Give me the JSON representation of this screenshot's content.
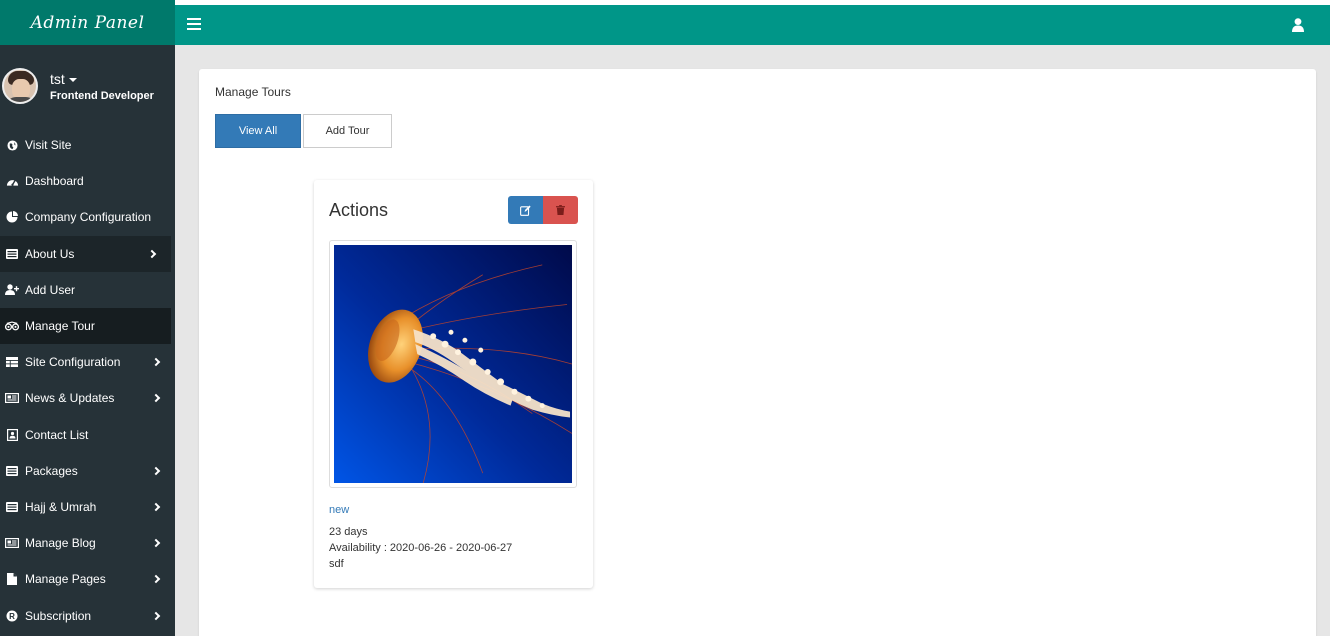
{
  "brand": "Admin Panel",
  "profile": {
    "name": "tst",
    "role": "Frontend Developer"
  },
  "menu": [
    {
      "label": "Visit Site",
      "icon": "globe-icon",
      "has_sub": false
    },
    {
      "label": "Dashboard",
      "icon": "tachometer-icon",
      "has_sub": false
    },
    {
      "label": "Company Configuration",
      "icon": "pie-chart-icon",
      "has_sub": false
    },
    {
      "label": "About Us",
      "icon": "list-icon",
      "has_sub": true
    },
    {
      "label": "Add User",
      "icon": "user-plus-icon",
      "has_sub": false
    },
    {
      "label": "Manage Tour",
      "icon": "binoculars-icon",
      "has_sub": false
    },
    {
      "label": "Site Configuration",
      "icon": "table-icon",
      "has_sub": true
    },
    {
      "label": "News & Updates",
      "icon": "newspaper-icon",
      "has_sub": true
    },
    {
      "label": "Contact List",
      "icon": "address-book-icon",
      "has_sub": false
    },
    {
      "label": "Packages",
      "icon": "list-icon",
      "has_sub": true
    },
    {
      "label": "Hajj & Umrah",
      "icon": "list-icon",
      "has_sub": true
    },
    {
      "label": "Manage Blog",
      "icon": "newspaper-icon",
      "has_sub": true
    },
    {
      "label": "Manage Pages",
      "icon": "file-icon",
      "has_sub": true
    },
    {
      "label": "Subscription",
      "icon": "registered-icon",
      "has_sub": true
    }
  ],
  "main": {
    "title": "Manage Tours",
    "buttons": {
      "view_all": "View All",
      "add_tour": "Add Tour"
    },
    "card": {
      "title": "Actions",
      "tour_name": "new",
      "duration": "23 days",
      "availability": "Availability : 2020-06-26 - 2020-06-27",
      "description": "sdf"
    }
  },
  "colors": {
    "topbar": "#009688",
    "brand_bg": "#00796b",
    "sidebar": "#263238",
    "primary": "#337ab7",
    "danger": "#d9534f"
  }
}
